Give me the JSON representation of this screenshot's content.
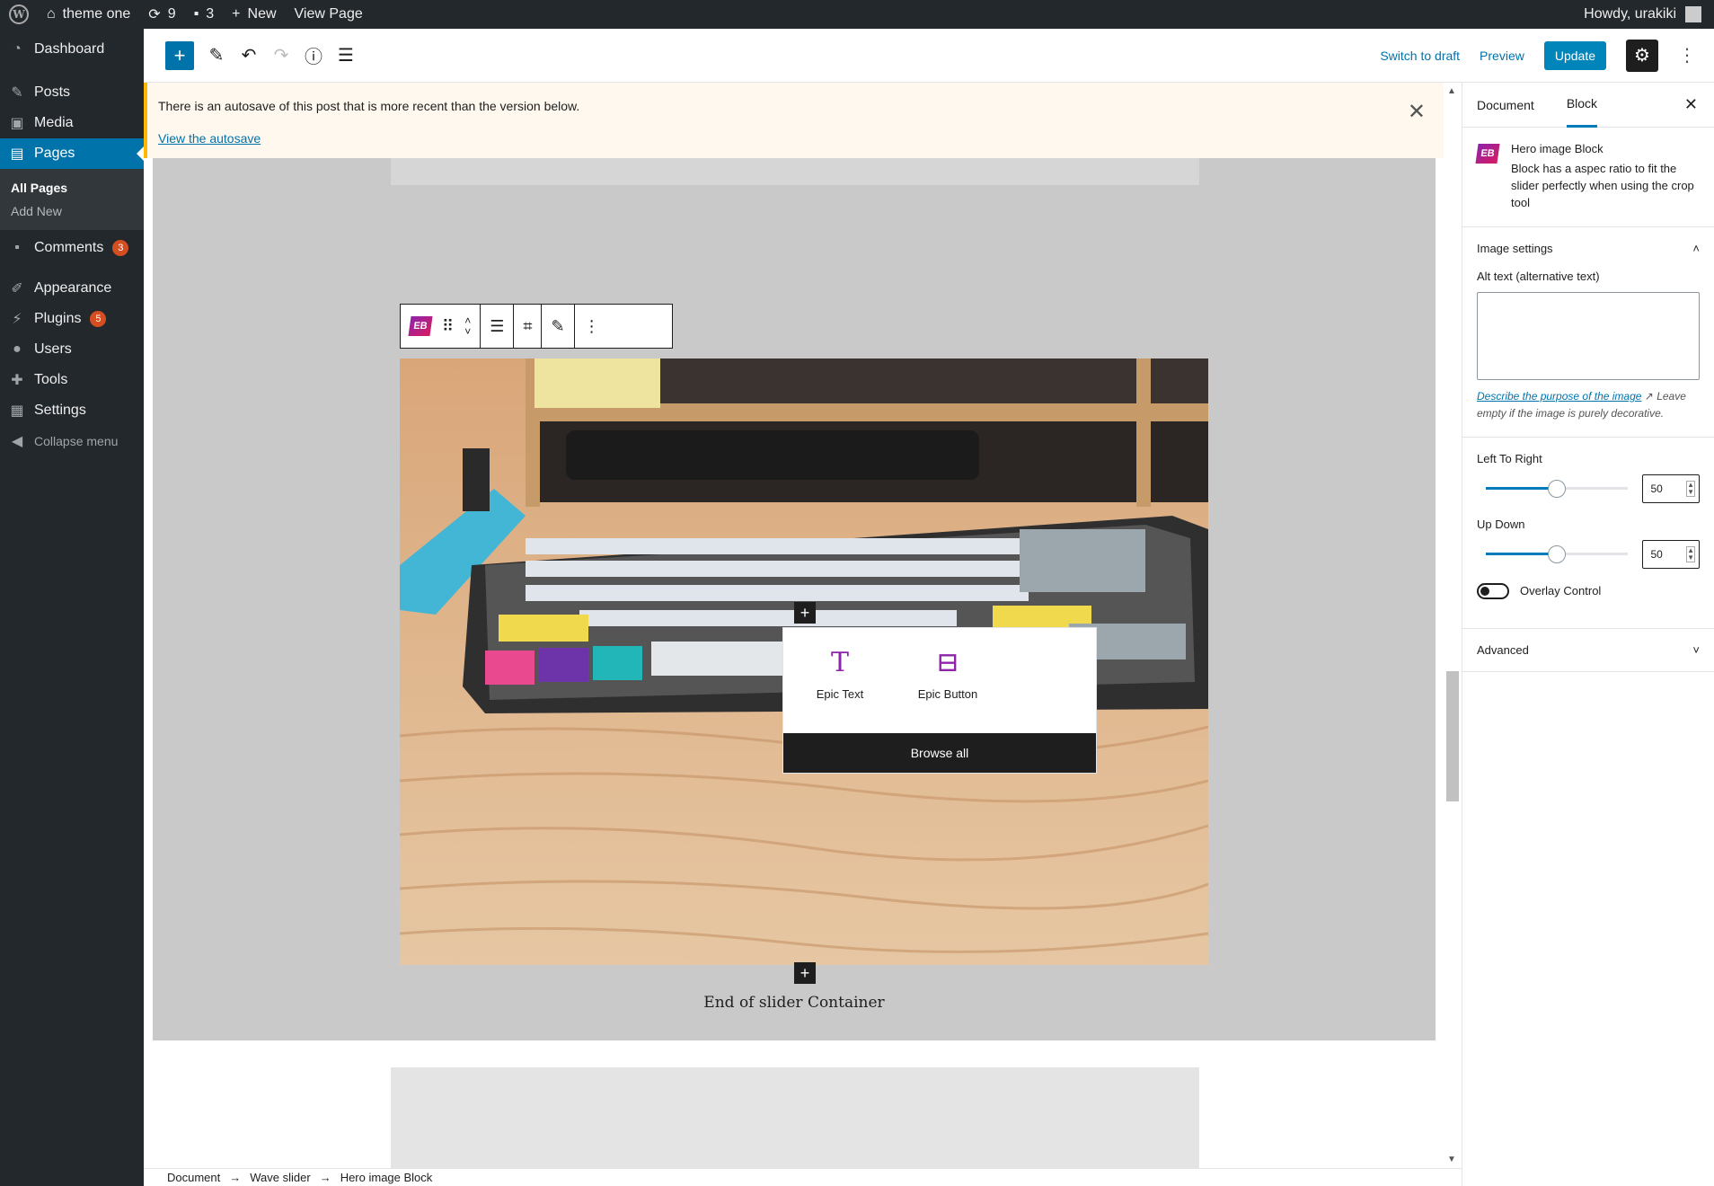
{
  "adminbar": {
    "site_name": "theme one",
    "updates_count": "9",
    "comments_count": "3",
    "new_label": "New",
    "view_page_label": "View Page",
    "greeting": "Howdy, urakiki"
  },
  "menu": {
    "dashboard": "Dashboard",
    "posts": "Posts",
    "media": "Media",
    "pages": "Pages",
    "all_pages": "All Pages",
    "add_new": "Add New",
    "comments": "Comments",
    "comments_badge": "3",
    "appearance": "Appearance",
    "plugins": "Plugins",
    "plugins_badge": "5",
    "users": "Users",
    "tools": "Tools",
    "settings": "Settings",
    "collapse": "Collapse menu"
  },
  "header": {
    "switch_to_draft": "Switch to draft",
    "preview": "Preview",
    "update": "Update"
  },
  "notice": {
    "text": "There is an autosave of this post that is more recent than the version below.",
    "link": "View the autosave"
  },
  "inserter": {
    "items": [
      {
        "label": "Epic Text",
        "icon": "T"
      },
      {
        "label": "Epic Button",
        "icon": "button-plus-icon"
      }
    ],
    "browse_all": "Browse all"
  },
  "canvas": {
    "end_text": "End of slider Container"
  },
  "breadcrumbs": [
    "Document",
    "Wave slider",
    "Hero image Block"
  ],
  "breadcrumb_separator": "→",
  "sidebar": {
    "tab_document": "Document",
    "tab_block": "Block",
    "block_title": "Hero image Block",
    "block_desc": "Block has a aspec ratio to fit the slider perfectly when using the crop tool",
    "image_settings": "Image settings",
    "alt_label": "Alt text (alternative text)",
    "help_link": "Describe the purpose of the image",
    "help_rest": "Leave empty if the image is purely decorative.",
    "left_to_right_label": "Left To Right",
    "left_to_right_value": "50",
    "up_down_label": "Up Down",
    "up_down_value": "50",
    "overlay_label": "Overlay Control",
    "advanced": "Advanced"
  },
  "colors": {
    "admin_dark": "#23282d",
    "accent_blue": "#0073aa",
    "badge_red": "#d54e21",
    "epic_purple": "#8e24aa"
  }
}
